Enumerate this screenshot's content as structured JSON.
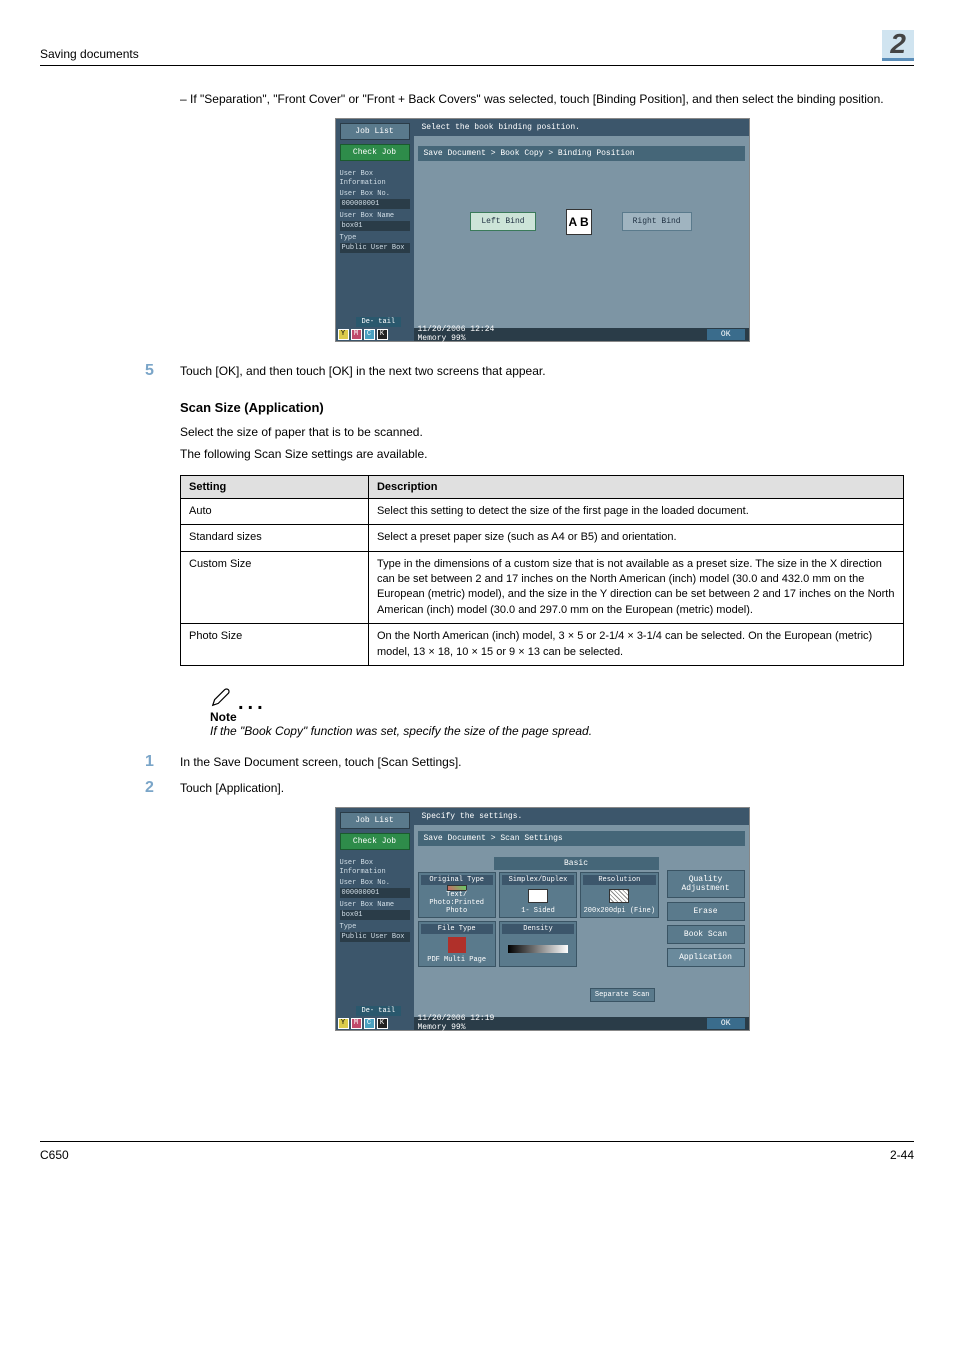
{
  "header": {
    "left": "Saving documents",
    "right": "2"
  },
  "bullet": "–   If \"Separation\", \"Front Cover\" or \"Front + Back Covers\" was selected, touch [Binding Position], and then select the binding position.",
  "ui1": {
    "job_list": "Job List",
    "check_job": "Check Job",
    "side_userbox": "User Box\nInformation",
    "side_box_no_lbl": "User Box No.",
    "side_box_no": "000000001",
    "side_box_name_lbl": "User Box Name",
    "side_box_name": "box01",
    "side_type_lbl": "Type",
    "side_type": "Public\nUser Box",
    "detail": "De-\ntail",
    "instruct": "Select the book binding position.",
    "breadcrumb": "Save Document > Book Copy > Binding Position",
    "left_bind": "Left Bind",
    "right_bind": "Right Bind",
    "ab": "A B",
    "datetime": "11/20/2006   12:24",
    "memory": "Memory      99%",
    "ok": "OK",
    "tb": {
      "y": "Y",
      "m": "M",
      "c": "C",
      "k": "K"
    }
  },
  "step5": {
    "num": "5",
    "text": "Touch [OK], and then touch [OK] in the next two screens that appear."
  },
  "section_heading": "Scan Size (Application)",
  "para1": "Select the size of paper that is to be scanned.",
  "para2": "The following Scan Size settings are available.",
  "table": {
    "h1": "Setting",
    "h2": "Description",
    "rows": [
      {
        "c1": "Auto",
        "c2": "Select this setting to detect the size of the first page in the loaded document."
      },
      {
        "c1": "Standard sizes",
        "c2": "Select a preset paper size (such as A4 or B5) and orientation."
      },
      {
        "c1": "Custom Size",
        "c2": "Type in the dimensions of a custom size that is not available as a preset size. The size in the X direction can be set between 2 and 17 inches on the North American (inch) model (30.0 and 432.0 mm on the European (metric) model), and the size in the Y direction can be set between 2 and 17 inches on the North American (inch) model (30.0 and 297.0 mm on the European (metric) model)."
      },
      {
        "c1": "Photo Size",
        "c2": "On the North American (inch) model, 3 × 5 or 2-1/4 × 3-1/4 can be selected. On the European (metric) model, 13 × 18, 10 × 15 or 9 × 13 can be selected."
      }
    ]
  },
  "note": {
    "label": "Note",
    "text": "If the \"Book Copy\" function was set, specify the size of the page spread."
  },
  "step1": {
    "num": "1",
    "text": "In the Save Document screen, touch [Scan Settings]."
  },
  "step2": {
    "num": "2",
    "text": "Touch [Application]."
  },
  "ui2": {
    "job_list": "Job List",
    "check_job": "Check Job",
    "instruct": "Specify the settings.",
    "breadcrumb": "Save Document > Scan Settings",
    "basic": "Basic",
    "orig_type": "Original Type",
    "orig_type_val": "Text/\nPhoto:Printed\nPhoto",
    "simplex": "Simplex/Duplex",
    "simplex_val": "1-\nSided",
    "resolution": "Resolution",
    "resolution_val": "200x200dpi\n(Fine)",
    "file_type": "File Type",
    "file_type_val": "PDF\nMulti Page",
    "density": "Density",
    "sep_scan": "Separate Scan",
    "quality": "Quality\nAdjustment",
    "erase": "Erase",
    "book_scan": "Book Scan",
    "application": "Application",
    "datetime": "11/20/2006   12:19",
    "memory": "Memory      99%",
    "ok": "OK"
  },
  "footer": {
    "left": "C650",
    "right": "2-44"
  }
}
